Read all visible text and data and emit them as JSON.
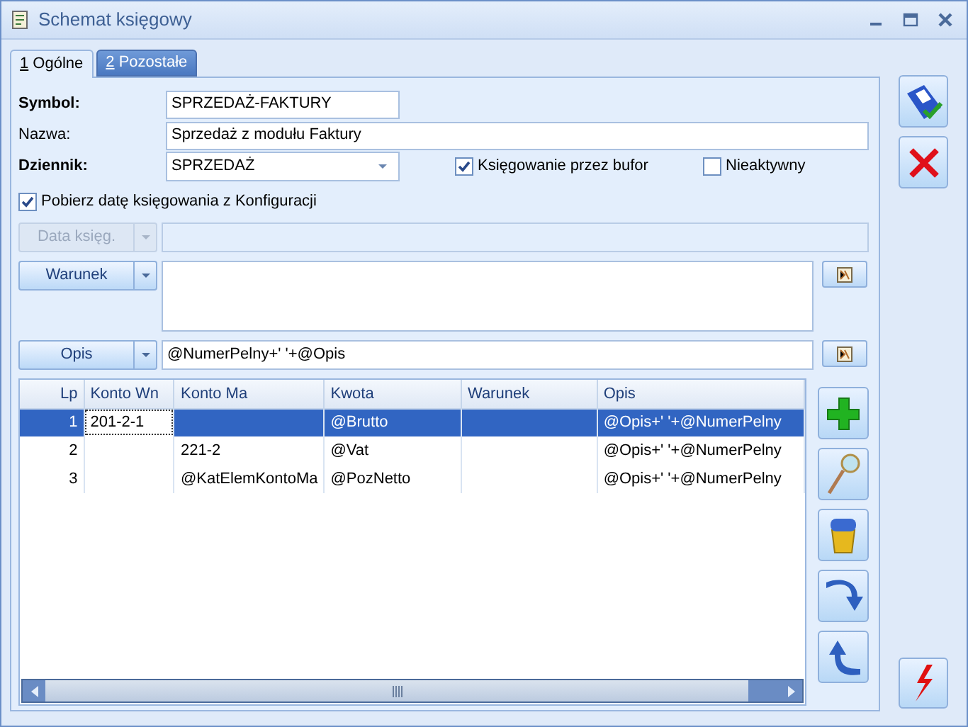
{
  "window": {
    "title": "Schemat księgowy"
  },
  "tabs": [
    {
      "key": "1",
      "label": " Ogólne",
      "selected": true
    },
    {
      "key": "2",
      "label": " Pozostałe",
      "selected": false
    }
  ],
  "symbol": {
    "label": "Symbol:",
    "value": "SPRZEDAŻ-FAKTURY"
  },
  "nazwa": {
    "label": "Nazwa:",
    "value": "Sprzedaż z modułu Faktury"
  },
  "dziennik": {
    "label": "Dziennik:",
    "value": "SPRZEDAŻ"
  },
  "checkboxes": [
    {
      "label": "Księgowanie przez bufor",
      "checked": true
    },
    {
      "label": "Nieaktywny",
      "checked": false
    },
    {
      "label": "Pobierz datę księgowania z Konfiguracji",
      "checked": true
    }
  ],
  "expressions": [
    {
      "kind": "field",
      "button": "Data księg.",
      "disabled": true
    },
    {
      "kind": "area",
      "button": "Warunek",
      "disabled": false
    },
    {
      "kind": "field",
      "button": "Opis",
      "disabled": false,
      "value": "@NumerPelny+' '+@Opis"
    }
  ],
  "table": {
    "columns": [
      "Lp",
      "Konto Wn",
      "Konto Ma",
      "Kwota",
      "Warunek",
      "Opis"
    ],
    "rows": [
      {
        "selected": true,
        "cells": [
          {
            "text": "1",
            "focused": false
          },
          {
            "text": "201-2-1",
            "focused": true
          },
          {
            "focused": false
          },
          {
            "text": "@Brutto",
            "focused": false
          },
          {
            "focused": false
          },
          {
            "text": "@Opis+' '+@NumerPelny",
            "focused": false
          }
        ]
      },
      {
        "selected": false,
        "cells": [
          {
            "text": "2",
            "focused": false
          },
          {
            "focused": false
          },
          {
            "text": "221-2",
            "focused": false
          },
          {
            "text": "@Vat",
            "focused": false
          },
          {
            "focused": false
          },
          {
            "text": "@Opis+' '+@NumerPelny",
            "focused": false
          }
        ]
      },
      {
        "selected": false,
        "cells": [
          {
            "text": "3",
            "focused": false
          },
          {
            "focused": false
          },
          {
            "text": "@KatElemKontoMa",
            "focused": false
          },
          {
            "text": "@PozNetto",
            "focused": false
          },
          {
            "focused": false
          },
          {
            "text": "@Opis+' '+@NumerPelny",
            "focused": false
          }
        ]
      }
    ]
  }
}
